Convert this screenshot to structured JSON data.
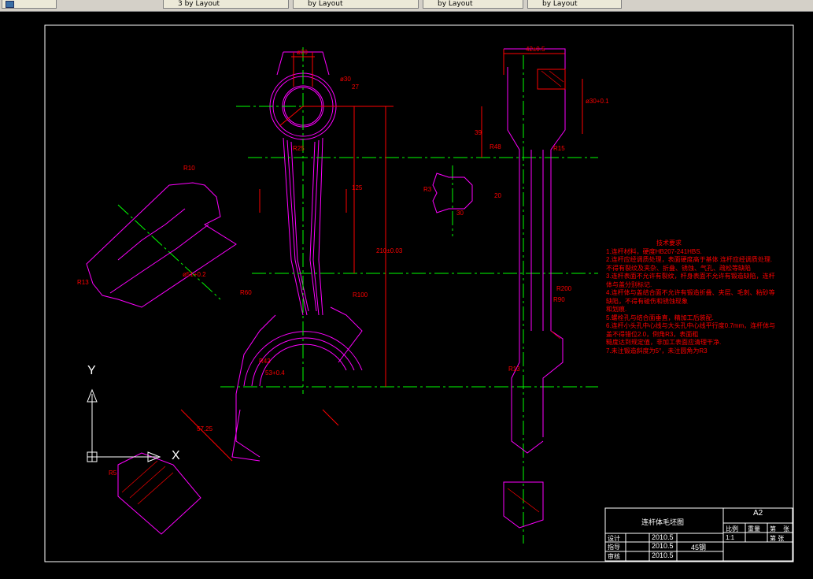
{
  "tabs": [
    {
      "label": ""
    },
    {
      "label": "3 by Layout"
    },
    {
      "label": "by Layout"
    },
    {
      "label": "by Layout"
    },
    {
      "label": "by Layout"
    }
  ],
  "axes": {
    "y_label": "Y",
    "x_label": "X"
  },
  "notes": {
    "title": "技术要求",
    "lines": [
      "1.连杆材料，硬度HB207-241HBS.",
      "2.连杆应经调质处理，表面硬度高于基体            连杆应经调质处理.",
      "  不得有裂纹及夹杂、折叠、锈蚀、气孔、疏松等缺陷",
      "3.连杆表面不允许有裂纹，杆身表面不允许有锻造缺陷，连杆体与盖分别标记.",
      "4.连杆体与盖结合面不允许有锻造折叠、夹层、毛刺、粘砂等缺陷，不得有碰伤和锈蚀现象",
      "  和划痕.",
      "5.螺栓孔与结合面垂直，精加工后装配.",
      "6.连杆小头孔中心线与大头孔中心线平行度0.7mm，连杆体与盖不得错位2.0，倒角R3，表面粗",
      "  糙度达到规定值，非加工表面应清理干净.",
      "7.未注锻造斜度为5°，未注圆角为R3"
    ]
  },
  "title_block": {
    "drawing_name": "连杆体毛坯图",
    "sheet_size": "A2",
    "col_scale": "比例",
    "col_weight": "重量",
    "col_sheet": "第",
    "col_sheets": "张",
    "scale_value": "1:1",
    "sheet_total": "第  张",
    "role_design": "设计",
    "role_drawing": "指导",
    "role_review": "审核",
    "date_design": "2010.5",
    "date_drawing": "2010.5",
    "date_review": "2010.5",
    "material": "45钢"
  },
  "dims": {
    "d20": "ø20",
    "d30": "ø30",
    "r27": "27",
    "r25": "R25",
    "h125": "125",
    "l210": "210±0.03",
    "r10": "R10",
    "r13": "R13",
    "r60": "R60",
    "r100": "R100",
    "r42": "R42",
    "d53": "53+0.4",
    "r5": "R5",
    "d57": "57.25",
    "w42": "42±0.5",
    "d30b": "ø30+0.1",
    "h39": "39",
    "r48": "R48",
    "r15": "R15",
    "r200": "R200",
    "r90": "R90",
    "r13b": "R13",
    "r3": "R3",
    "d30c": "30",
    "d20c": "20",
    "d51": "ø51+0.2"
  }
}
